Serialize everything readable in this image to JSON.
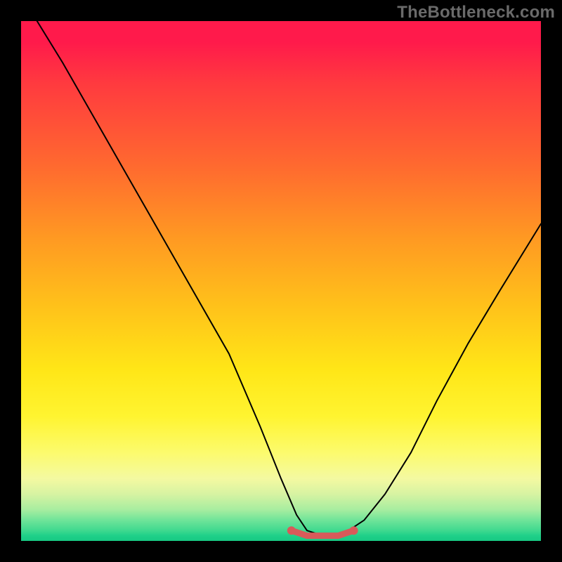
{
  "watermark": "TheBottleneck.com",
  "chart_data": {
    "type": "line",
    "title": "",
    "xlabel": "",
    "ylabel": "",
    "xlim": [
      0,
      100
    ],
    "ylim": [
      0,
      100
    ],
    "grid": false,
    "legend": false,
    "series": [
      {
        "name": "bottleneck-curve",
        "x": [
          0,
          8,
          16,
          24,
          32,
          40,
          46,
          50,
          53,
          55,
          58,
          60,
          63,
          66,
          70,
          75,
          80,
          86,
          92,
          100
        ],
        "values": [
          105,
          92,
          78,
          64,
          50,
          36,
          22,
          12,
          5,
          2,
          1,
          1,
          2,
          4,
          9,
          17,
          27,
          38,
          48,
          61
        ]
      },
      {
        "name": "flat-floor-highlight",
        "x": [
          52,
          55,
          58,
          61,
          64
        ],
        "values": [
          2,
          1,
          1,
          1,
          2
        ]
      }
    ],
    "colors": {
      "curve": "#000000",
      "highlight": "#d85a5a",
      "background_top": "#ff1a4b",
      "background_bottom": "#18c883"
    }
  }
}
